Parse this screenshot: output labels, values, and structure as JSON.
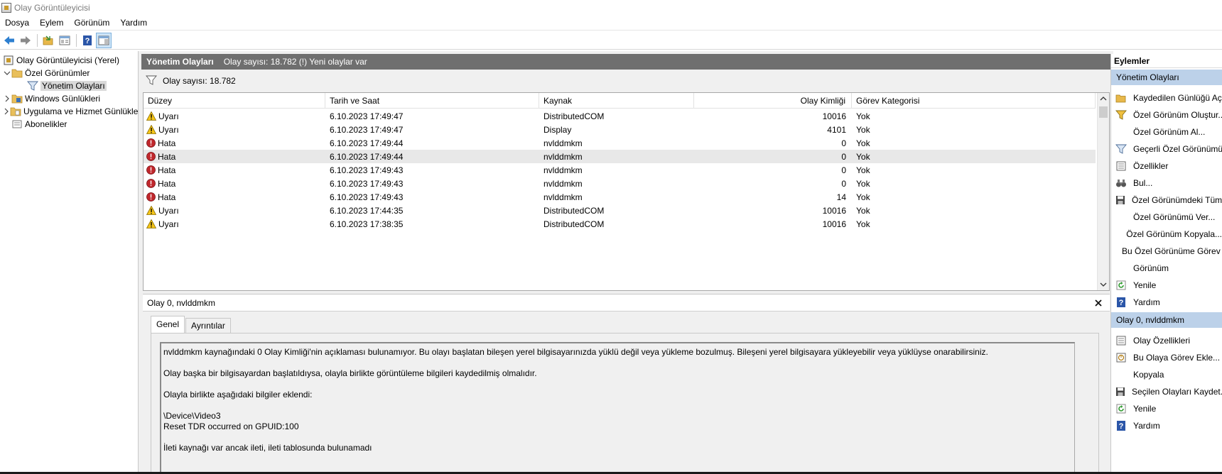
{
  "window": {
    "title": "Olay Görüntüleyicisi"
  },
  "menu": [
    "Dosya",
    "Eylem",
    "Görünüm",
    "Yardım"
  ],
  "toolbar": {
    "buttons": [
      "back-arrow-icon",
      "forward-arrow-icon",
      "open-folder-icon",
      "properties-panel-icon",
      "help-icon",
      "show-hide-pane-icon"
    ]
  },
  "tree": {
    "items": [
      {
        "label": "Olay Görüntüleyicisi (Yerel)",
        "icon": "event-viewer-icon",
        "indent": 0,
        "chevron": ""
      },
      {
        "label": "Özel Görünümler",
        "icon": "folder-icon",
        "indent": 0,
        "chevron": "down"
      },
      {
        "label": "Yönetim Olayları",
        "icon": "filter-icon",
        "indent": 2,
        "chevron": ""
      },
      {
        "label": "Windows Günlükleri",
        "icon": "log-folder-icon",
        "indent": 0,
        "chevron": "right"
      },
      {
        "label": "Uygulama ve Hizmet Günlükleri",
        "icon": "log-folder-icon",
        "indent": 0,
        "chevron": "right"
      },
      {
        "label": "Abonelikler",
        "icon": "subscriptions-icon",
        "indent": 0,
        "chevron": ""
      }
    ]
  },
  "middle": {
    "header_title": "Yönetim Olayları",
    "header_info": "Olay sayısı: 18.782 (!) Yeni olaylar var",
    "filter_count": "Olay sayısı: 18.782",
    "columns": [
      "Düzey",
      "Tarih ve Saat",
      "Kaynak",
      "Olay Kimliği",
      "Görev Kategorisi"
    ],
    "rows": [
      {
        "level": "Uyarı",
        "type": "warning",
        "datetime": "6.10.2023 17:49:47",
        "source": "DistributedCOM",
        "id": "10016",
        "category": "Yok"
      },
      {
        "level": "Uyarı",
        "type": "warning",
        "datetime": "6.10.2023 17:49:47",
        "source": "Display",
        "id": "4101",
        "category": "Yok"
      },
      {
        "level": "Hata",
        "type": "error",
        "datetime": "6.10.2023 17:49:44",
        "source": "nvlddmkm",
        "id": "0",
        "category": "Yok"
      },
      {
        "level": "Hata",
        "type": "error",
        "datetime": "6.10.2023 17:49:44",
        "source": "nvlddmkm",
        "id": "0",
        "category": "Yok",
        "selected": true
      },
      {
        "level": "Hata",
        "type": "error",
        "datetime": "6.10.2023 17:49:43",
        "source": "nvlddmkm",
        "id": "0",
        "category": "Yok"
      },
      {
        "level": "Hata",
        "type": "error",
        "datetime": "6.10.2023 17:49:43",
        "source": "nvlddmkm",
        "id": "0",
        "category": "Yok"
      },
      {
        "level": "Hata",
        "type": "error",
        "datetime": "6.10.2023 17:49:43",
        "source": "nvlddmkm",
        "id": "14",
        "category": "Yok"
      },
      {
        "level": "Uyarı",
        "type": "warning",
        "datetime": "6.10.2023 17:44:35",
        "source": "DistributedCOM",
        "id": "10016",
        "category": "Yok"
      },
      {
        "level": "Uyarı",
        "type": "warning",
        "datetime": "6.10.2023 17:38:35",
        "source": "DistributedCOM",
        "id": "10016",
        "category": "Yok"
      }
    ]
  },
  "detail": {
    "title": "Olay 0, nvlddmkm",
    "tabs": [
      "Genel",
      "Ayrıntılar"
    ],
    "lines": {
      "p1": "nvlddmkm kaynağındaki 0 Olay Kimliği'nin açıklaması bulunamıyor. Bu olayı başlatan bileşen yerel bilgisayarınızda yüklü değil veya yükleme bozulmuş. Bileşeni yerel bilgisayara yükleyebilir veya yüklüyse onarabilirsiniz.",
      "p2": "Olay başka bir bilgisayardan başlatıldıysa, olayla birlikte görüntüleme bilgileri kaydedilmiş olmalıdır.",
      "p3": "Olayla birlikte aşağıdaki bilgiler eklendi:",
      "p4a": "\\Device\\Video3",
      "p4b": "Reset TDR occurred on GPUID:100",
      "p5": "İleti kaynağı var ancak ileti, ileti tablosunda bulunamadı"
    }
  },
  "actions": {
    "title": "Eylemler",
    "sections": [
      {
        "title": "Yönetim Olayları",
        "items": [
          {
            "label": "Kaydedilen Günlüğü Aç...",
            "icon": "open-folder-icon"
          },
          {
            "label": "Özel Görünüm Oluştur...",
            "icon": "create-filter-icon"
          },
          {
            "label": "Özel Görünüm Al...",
            "icon": ""
          },
          {
            "label": "Geçerli Özel Görünümü Filtrele...",
            "icon": "filter-icon"
          },
          {
            "label": "Özellikler",
            "icon": "properties-icon"
          },
          {
            "label": "Bul...",
            "icon": "binoculars-icon"
          },
          {
            "label": "Özel Görünümdeki Tüm Olayları Farklı Kaydet...",
            "icon": "save-icon"
          },
          {
            "label": "Özel Görünümü Ver...",
            "icon": ""
          },
          {
            "label": "Özel Görünüm Kopyala...",
            "icon": ""
          },
          {
            "label": "Bu Özel Görünüme Görev Ekle...",
            "icon": ""
          },
          {
            "label": "Görünüm",
            "icon": ""
          },
          {
            "label": "Yenile",
            "icon": "refresh-icon"
          },
          {
            "label": "Yardım",
            "icon": "help-icon"
          }
        ]
      },
      {
        "title": "Olay 0, nvlddmkm",
        "items": [
          {
            "label": "Olay Özellikleri",
            "icon": "properties-icon"
          },
          {
            "label": "Bu Olaya Görev Ekle...",
            "icon": "task-icon"
          },
          {
            "label": "Kopyala",
            "icon": ""
          },
          {
            "label": "Seçilen Olayları Kaydet...",
            "icon": "save-icon"
          },
          {
            "label": "Yenile",
            "icon": "refresh-icon"
          },
          {
            "label": "Yardım",
            "icon": "help-icon"
          }
        ]
      }
    ]
  },
  "colors": {
    "header_bg": "#6f6f6f",
    "section_bg": "#bcd1e9",
    "warning": "#f5c518",
    "error": "#c0282d",
    "help_blue": "#2b56a8"
  }
}
